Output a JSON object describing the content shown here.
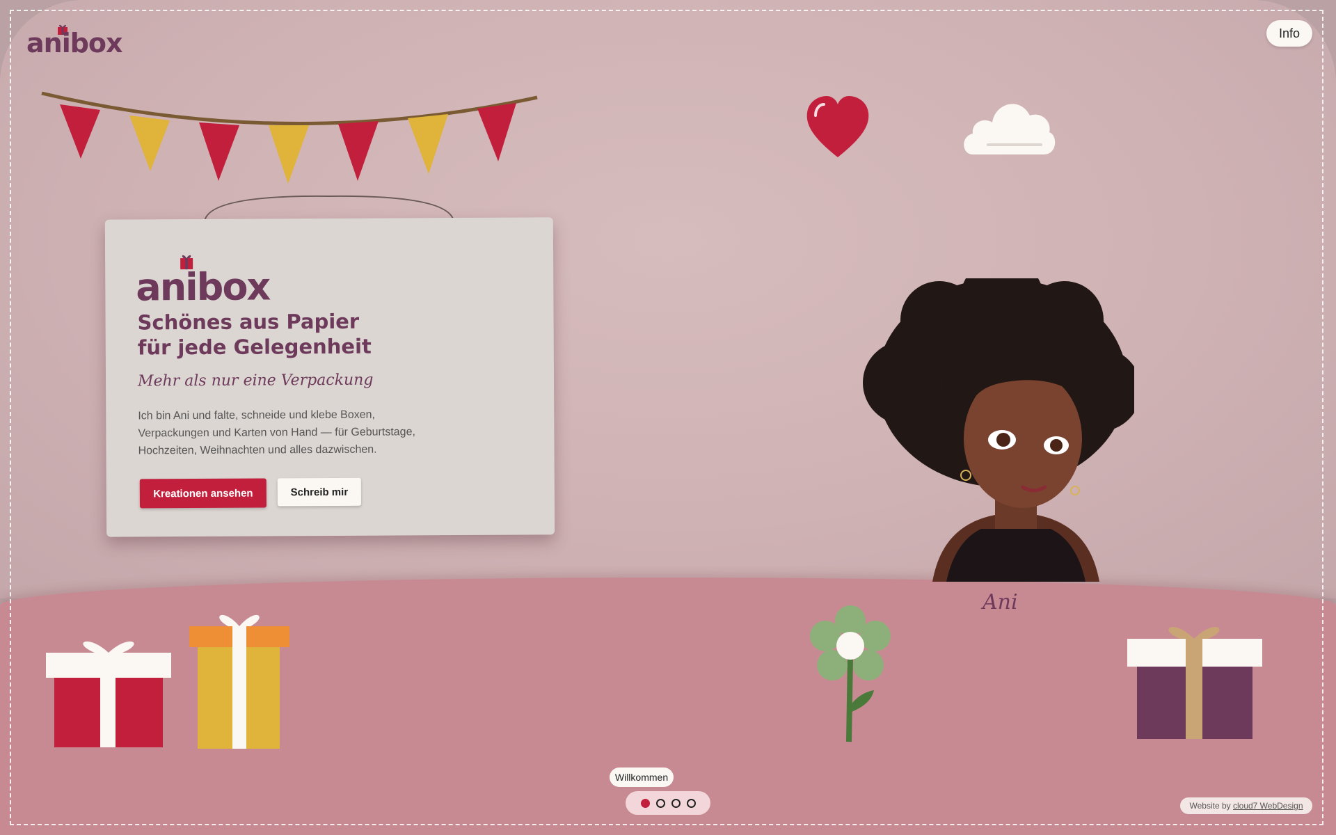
{
  "header": {
    "logo_text": "anibox",
    "info_label": "Info"
  },
  "card": {
    "logo_text": "anibox",
    "title_line1": "Schönes aus Papier",
    "title_line2": "für jede Gelegenheit",
    "subtitle": "Mehr als nur eine Verpackung",
    "body_line1": "Ich bin Ani und falte, schneide und klebe Boxen,",
    "body_line2": "Verpackungen und Karten von Hand — für Geburtstage,",
    "body_line3": "Hochzeiten, Weihnachten und alles dazwischen.",
    "primary_button": "Kreationen ansehen",
    "secondary_button": "Schreib mir"
  },
  "character": {
    "name_label": "Ani"
  },
  "slider": {
    "current_label": "Willkommen",
    "total_slides": 4,
    "active_index": 0
  },
  "footer": {
    "credit_prefix": "Website by",
    "credit_link": "cloud7 WebDesign"
  },
  "colors": {
    "brand_purple": "#6e3a5b",
    "accent_red": "#c21f3c",
    "mustard": "#e0b33a",
    "wall": "#d2b6b8",
    "floor": "#c88a92",
    "card": "#dcd6d2"
  },
  "icons": [
    "gift-logo-icon",
    "heart-icon",
    "cloud-icon",
    "bunting-garland",
    "gift-box-icon",
    "flower-icon"
  ]
}
